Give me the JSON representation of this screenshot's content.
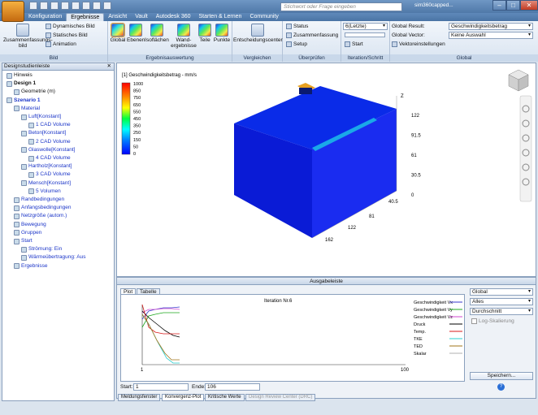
{
  "quick_access": {
    "search_placeholder": "Stichwort oder Frage eingeben",
    "user": "sim360capped..."
  },
  "tabs": [
    "Konfiguration",
    "Ergebnisse",
    "Ansicht",
    "Vault",
    "Autodesk 360",
    "Starten & Lernen",
    "Community"
  ],
  "active_tab": "Ergebnisse",
  "ribbon": {
    "bild": {
      "label": "Bild",
      "summary": "Zusammenfassungs-bild",
      "dynamic": "Dynamisches Bild",
      "static": "Statisches Bild",
      "animation": "Animation"
    },
    "ergebnis": {
      "label": "Ergebnisauswertung",
      "global": "Global",
      "ebenen": "Ebenen",
      "isoflaechen": "Isoflächen",
      "wand": "Wand-ergebnisse",
      "teile": "Teile",
      "punkte": "Punkte"
    },
    "vergleichen": {
      "label": "Vergleichen",
      "center": "Entscheidungscenter"
    },
    "ueberpruefen": {
      "label": "Überprüfen",
      "status": "Status",
      "zusammenfassung": "Zusammenfassung",
      "setup": "Setup"
    },
    "iteration": {
      "label": "Iteration/Schritt",
      "combo": "6(Letzte)",
      "start": "Start"
    },
    "global": {
      "label": "Global",
      "result_label": "Global Result:",
      "result_value": "Geschwindigkeitsbetrag",
      "vector_label": "Global Vector:",
      "vector_value": "Keine Auswahl",
      "vector_settings": "Vektoreinstellungen"
    }
  },
  "left_panel": {
    "title": "Designstudienleiste",
    "items": [
      {
        "label": "Hinweis",
        "indent": 0
      },
      {
        "label": "Design 1",
        "indent": 0
      },
      {
        "label": "Geometrie (m)",
        "indent": 1
      },
      {
        "label": "Szenario 1",
        "indent": 0
      },
      {
        "label": "Material",
        "indent": 1
      },
      {
        "label": "Luft[Konstant]",
        "indent": 2
      },
      {
        "label": "1 CAD Volume",
        "indent": 3
      },
      {
        "label": "Beton[Konstant]",
        "indent": 2
      },
      {
        "label": "2 CAD Volume",
        "indent": 3
      },
      {
        "label": "Glaswolle[Konstant]",
        "indent": 2
      },
      {
        "label": "4 CAD Volume",
        "indent": 3
      },
      {
        "label": "Hartholz[Konstant]",
        "indent": 2
      },
      {
        "label": "3 CAD Volume",
        "indent": 3
      },
      {
        "label": "Mensch[Konstant]",
        "indent": 2
      },
      {
        "label": "5 Volumen",
        "indent": 3
      },
      {
        "label": "Randbedingungen",
        "indent": 1
      },
      {
        "label": "Anfangsbedingungen",
        "indent": 1
      },
      {
        "label": "Netzgröße (autom.)",
        "indent": 1
      },
      {
        "label": "Bewegung",
        "indent": 1
      },
      {
        "label": "Gruppen",
        "indent": 1
      },
      {
        "label": "Start",
        "indent": 1
      },
      {
        "label": "Strömung: Ein",
        "indent": 2
      },
      {
        "label": "Wärmeübertragung: Aus",
        "indent": 2
      },
      {
        "label": "Ergebnisse",
        "indent": 1
      }
    ]
  },
  "viewport": {
    "legend_title": "[1] Geschwindigkeitsbetrag - mm/s",
    "legend_values": [
      "1000",
      "850",
      "750",
      "650",
      "550",
      "450",
      "350",
      "250",
      "150",
      "50",
      "0"
    ],
    "z_ticks": [
      "122",
      "91.5",
      "61",
      "30.5",
      "0"
    ],
    "y_ticks": [
      "40.5",
      "81",
      "122",
      "162"
    ],
    "z_axis_label": "Z"
  },
  "bottom": {
    "title": "Ausgabeleiste",
    "subtabs": [
      "Plot",
      "Tabelle"
    ],
    "plot_title": "Iteration Nr.6",
    "x_start": "1",
    "x_end": "100",
    "series": [
      {
        "name": "Geschwindigkeit Vx",
        "color": "#3a3acc"
      },
      {
        "name": "Geschwindigkeit Vy",
        "color": "#1fa81f"
      },
      {
        "name": "Geschwindigkeit Vz",
        "color": "#d04ad0"
      },
      {
        "name": "Druck",
        "color": "#000000"
      },
      {
        "name": "Temp.",
        "color": "#d81a1a"
      },
      {
        "name": "TKE",
        "color": "#2ad0d0"
      },
      {
        "name": "TED",
        "color": "#a0741a"
      },
      {
        "name": "Skalar",
        "color": "#b0b0b0"
      }
    ],
    "combos": [
      "Global",
      "Alles",
      "Durchschnitt"
    ],
    "log_label": "Log-Skalierung",
    "save_label": "Speichern...",
    "start_label": "Start:",
    "start_value": "1",
    "end_label": "Ende:",
    "end_value": "106"
  },
  "bottom_tabs": [
    "Meldungsfenster",
    "Konvergenz-Plot",
    "Kritische Werte",
    "Design Review Center (DRC)"
  ]
}
